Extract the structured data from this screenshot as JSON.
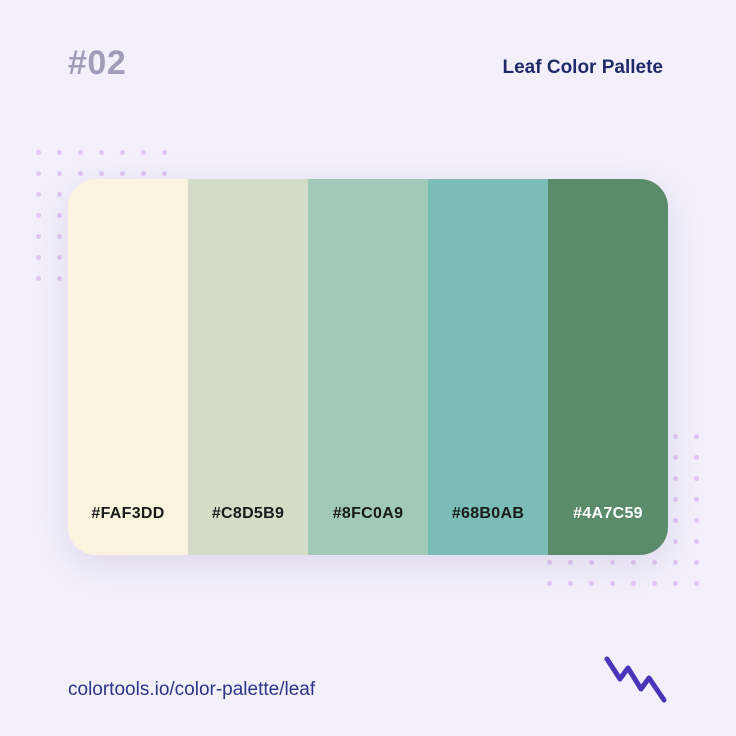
{
  "header": {
    "number": "#02",
    "title": "Leaf Color Pallete"
  },
  "palette": {
    "swatches": [
      {
        "hex": "#FAF3DD",
        "color": "#FAF3DD",
        "text_color": "#1a1a1a"
      },
      {
        "hex": "#C8D5B9",
        "color": "#D2DCC6",
        "text_color": "#1a1a1a"
      },
      {
        "hex": "#8FC0A9",
        "color": "#A0CAB7",
        "text_color": "#1a1a1a"
      },
      {
        "hex": "#68B0AB",
        "color": "#7ABCB6",
        "text_color": "#1a1a1a"
      },
      {
        "hex": "#4A7C59",
        "color": "#5A8B6B",
        "text_color": "#ffffff"
      }
    ]
  },
  "footer": {
    "url": "colortools.io/color-palette/leaf"
  },
  "colors": {
    "background": "#f3f0fb",
    "dot": "#e1c6f3",
    "accent": "#4a34b8",
    "title": "#1f2a6b",
    "number": "#a19db8"
  },
  "decor": {
    "zigzag_icon": "zigzag-icon"
  }
}
